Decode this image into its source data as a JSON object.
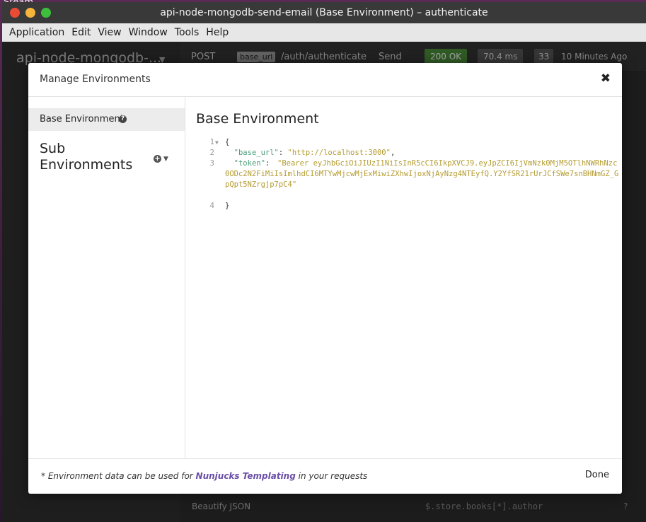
{
  "desktop": {
    "top_text": "Steam"
  },
  "window": {
    "title": "api-node-mongodb-send-email (Base Environment) – authenticate"
  },
  "menu": {
    "items": [
      "Application",
      "Edit",
      "View",
      "Window",
      "Tools",
      "Help"
    ]
  },
  "background_app": {
    "workspace_name": "api-node-mongodb-...",
    "method": "POST",
    "base_url_tag": "base_url",
    "path": "/auth/authenticate",
    "send_label": "Send",
    "status": "200 OK",
    "time": "70.4 ms",
    "size": "33",
    "ago": "10 Minutes Ago",
    "beautify_label": "Beautify JSON",
    "filter_placeholder": "$.store.books[*].author"
  },
  "modal": {
    "title": "Manage Environments",
    "base_env_label": "Base Environment",
    "sub_env_label": "Sub Environments",
    "env_heading": "Base Environment",
    "code": {
      "line_numbers": [
        "1",
        "2",
        "3",
        "4"
      ],
      "open_brace": "{",
      "close_brace": "}",
      "key1": "\"base_url\"",
      "val1": "\"http://localhost:3000\"",
      "key2": "\"token\"",
      "val2": "\"Bearer eyJhbGciOiJIUzI1NiIsInR5cCI6IkpXVCJ9.eyJpZCI6IjVmNzk0MjM5OTlhNWRhNzc0ODc2N2FiMiIsImlhdCI6MTYwMjcwMjExMiwiZXhwIjoxNjAyNzg4NTEyfQ.Y2YfSR21rUrJCfSWe7snBHNmGZ_GpQpt5NZrgjp7pC4\""
    },
    "footer_prefix": "* Environment data can be used for ",
    "footer_link": "Nunjucks Templating",
    "footer_suffix": " in your requests",
    "done_label": "Done"
  }
}
